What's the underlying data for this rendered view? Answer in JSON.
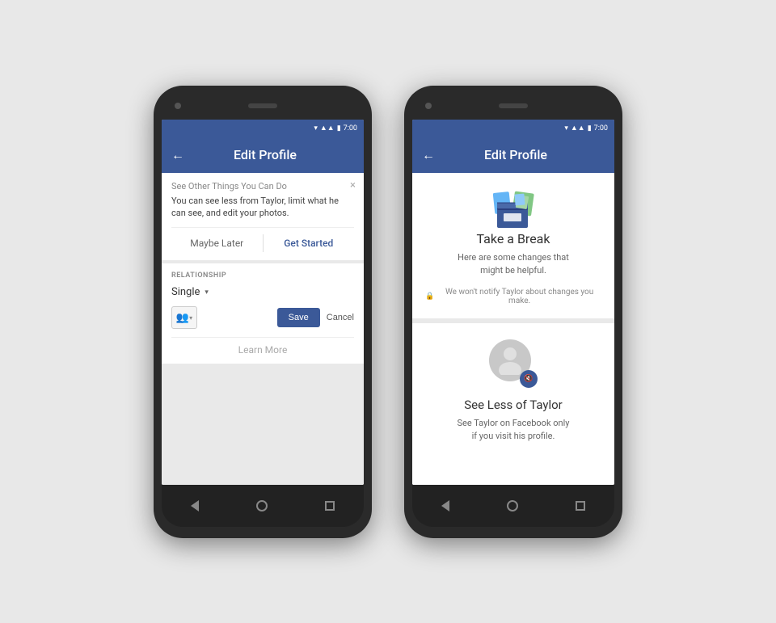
{
  "phone_left": {
    "status": {
      "time": "7:00"
    },
    "app_bar": {
      "title": "Edit Profile",
      "back_label": "←"
    },
    "notification": {
      "title": "See Other Things You Can Do",
      "body": "You can see less from Taylor, limit what he can see, and edit your photos.",
      "maybe_later": "Maybe Later",
      "get_started": "Get Started",
      "close": "×"
    },
    "relationship": {
      "label": "RELATIONSHIP",
      "value": "Single",
      "save_btn": "Save",
      "cancel_btn": "Cancel",
      "learn_more": "Learn More"
    }
  },
  "phone_right": {
    "status": {
      "time": "7:00"
    },
    "app_bar": {
      "title": "Edit Profile",
      "back_label": "←"
    },
    "take_a_break": {
      "title": "Take a Break",
      "subtitle_line1": "Here are some changes that",
      "subtitle_line2": "might be helpful.",
      "privacy_note": "We won't notify Taylor about changes you make."
    },
    "see_less": {
      "title": "See Less of Taylor",
      "subtitle_line1": "See Taylor on Facebook only",
      "subtitle_line2": "if you visit his profile.",
      "mute_icon": "🔇"
    }
  }
}
